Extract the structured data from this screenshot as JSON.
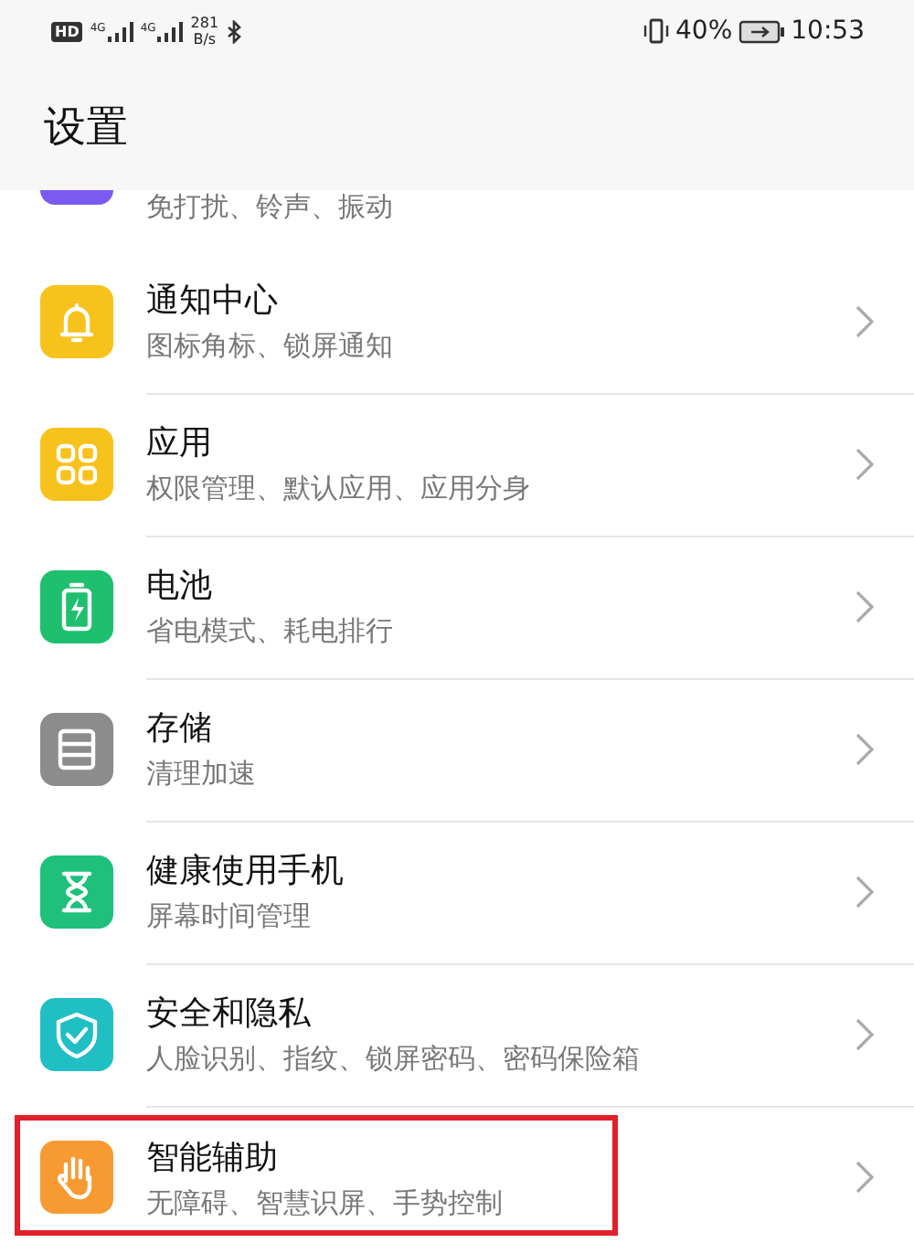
{
  "status_bar": {
    "hd": "HD",
    "signals": [
      {
        "label": "4G"
      },
      {
        "label": "4G"
      }
    ],
    "speed_value": "281",
    "speed_unit": "B/s",
    "battery": "40%",
    "time": "10:53"
  },
  "title": "设置",
  "items": [
    {
      "kind": "sound",
      "color": "#7a5af0",
      "subtitle": "免打扰、铃声、振动",
      "highlighted": false
    },
    {
      "kind": "bell",
      "color": "#f8c21c",
      "title": "通知中心",
      "subtitle": "图标角标、锁屏通知",
      "highlighted": false
    },
    {
      "kind": "apps",
      "color": "#f8c21c",
      "title": "应用",
      "subtitle": "权限管理、默认应用、应用分身",
      "highlighted": false
    },
    {
      "kind": "battery",
      "color": "#1ec06e",
      "title": "电池",
      "subtitle": "省电模式、耗电排行",
      "highlighted": false
    },
    {
      "kind": "storage",
      "color": "#8c8c8c",
      "title": "存储",
      "subtitle": "清理加速",
      "highlighted": false
    },
    {
      "kind": "hourglass",
      "color": "#1ec07c",
      "title": "健康使用手机",
      "subtitle": "屏幕时间管理",
      "highlighted": false
    },
    {
      "kind": "shield",
      "color": "#1fbfc4",
      "title": "安全和隐私",
      "subtitle": "人脸识别、指纹、锁屏密码、密码保险箱",
      "highlighted": false
    },
    {
      "kind": "hand",
      "color": "#f89a32",
      "title": "智能辅助",
      "subtitle": "无障碍、智慧识屏、手势控制",
      "highlighted": true
    }
  ]
}
